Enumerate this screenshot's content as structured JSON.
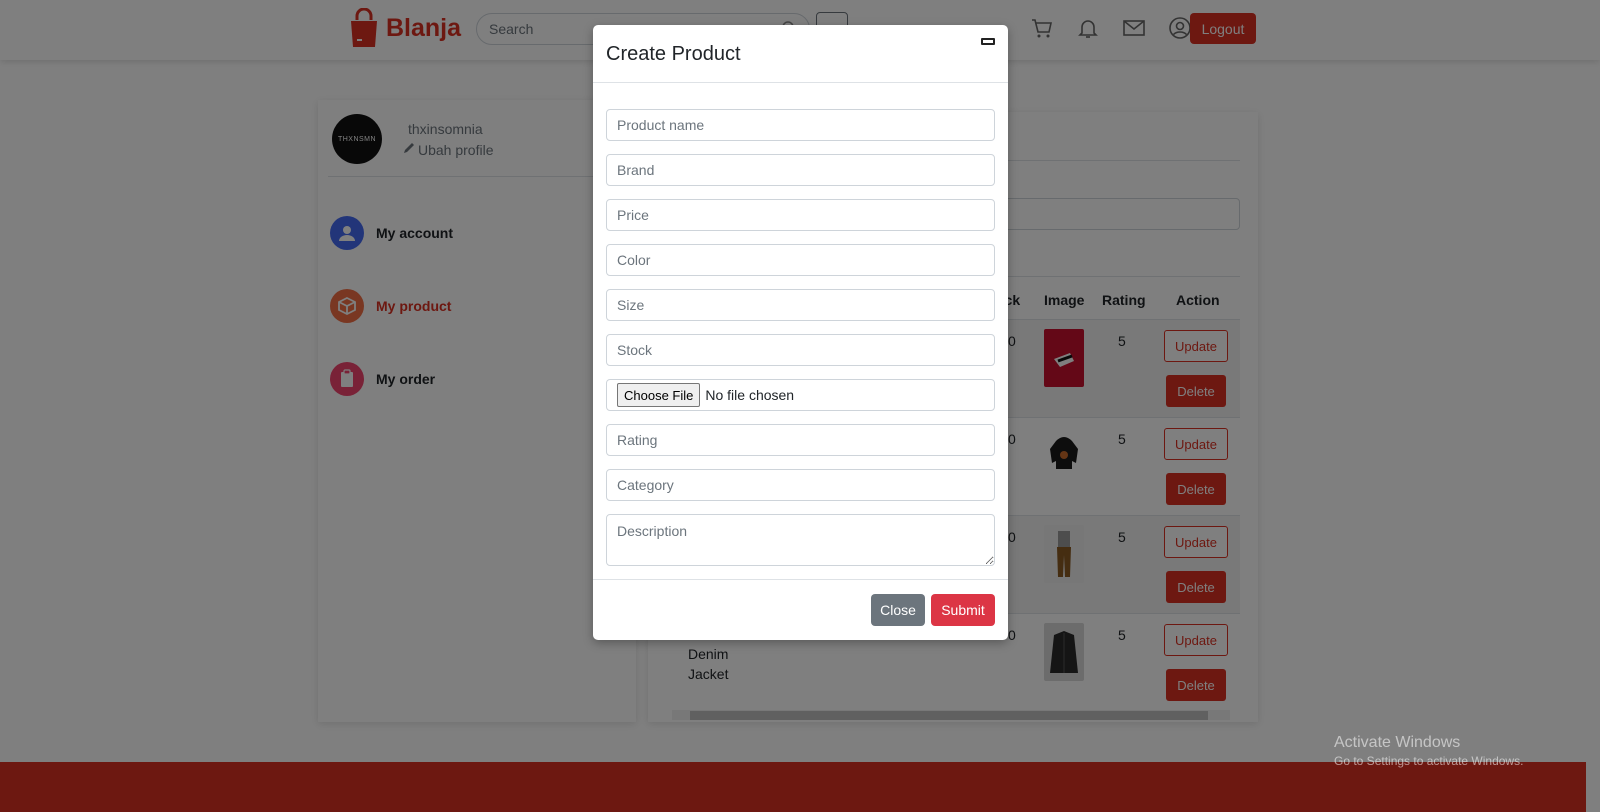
{
  "navbar": {
    "brand": "Blanja",
    "search_placeholder": "Search",
    "logout_label": "Logout"
  },
  "profile": {
    "avatar_text": "THXNSMN",
    "username": "thxinsomnia",
    "edit_label": "Ubah profile"
  },
  "sidebar": {
    "items": [
      {
        "label": "My account",
        "color": "#456bf3"
      },
      {
        "label": "My product",
        "color": "#f36f45"
      },
      {
        "label": "My order",
        "color": "#f3456f"
      }
    ]
  },
  "table": {
    "headers": {
      "stock": "ock",
      "image": "Image",
      "rating": "Rating",
      "action": "Action"
    },
    "rows": [
      {
        "stock": "0",
        "rating": "5",
        "update": "Update",
        "delete": "Delete",
        "name": ""
      },
      {
        "stock": "0",
        "rating": "5",
        "update": "Update",
        "delete": "Delete",
        "name": ""
      },
      {
        "stock": "0",
        "rating": "5",
        "update": "Update",
        "delete": "Delete",
        "name": ""
      },
      {
        "stock": "0",
        "rating": "5",
        "update": "Update",
        "delete": "Delete",
        "name_line1": "Denim",
        "name_line2": "Jacket"
      }
    ]
  },
  "modal": {
    "title": "Create Product",
    "fields": {
      "product_name": "Product name",
      "brand": "Brand",
      "price": "Price",
      "color": "Color",
      "size": "Size",
      "stock": "Stock",
      "rating": "Rating",
      "category": "Category",
      "description": "Description"
    },
    "file": {
      "button": "Choose File",
      "status": "No file chosen"
    },
    "close_label": "Close",
    "submit_label": "Submit"
  },
  "watermark": {
    "line1": "Activate Windows",
    "line2": "Go to Settings to activate Windows."
  },
  "colors": {
    "brand": "#db3022",
    "danger": "#dc3545",
    "secondary": "#6c757d"
  }
}
